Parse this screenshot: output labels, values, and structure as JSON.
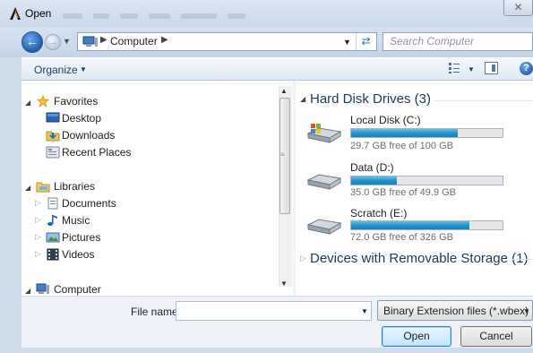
{
  "window": {
    "title": "Open",
    "close_glyph": "✕"
  },
  "address": {
    "path": [
      "Computer"
    ],
    "search_placeholder": "Search Computer"
  },
  "toolbar": {
    "organize_label": "Organize"
  },
  "nav": {
    "favorites": {
      "label": "Favorites",
      "items": [
        {
          "label": "Desktop",
          "icon": "desktop-icon"
        },
        {
          "label": "Downloads",
          "icon": "downloads-icon"
        },
        {
          "label": "Recent Places",
          "icon": "recent-places-icon"
        }
      ]
    },
    "libraries": {
      "label": "Libraries",
      "items": [
        {
          "label": "Documents",
          "icon": "documents-icon"
        },
        {
          "label": "Music",
          "icon": "music-icon"
        },
        {
          "label": "Pictures",
          "icon": "pictures-icon"
        },
        {
          "label": "Videos",
          "icon": "videos-icon"
        }
      ]
    },
    "computer": {
      "label": "Computer"
    }
  },
  "content": {
    "hard_disk_group": "Hard Disk Drives (3)",
    "drives": [
      {
        "name": "Local Disk (C:)",
        "free_text": "29.7 GB free of 100 GB",
        "used_fraction": 0.703,
        "icon": "windows-drive-icon"
      },
      {
        "name": "Data (D:)",
        "free_text": "35.0 GB free of 49.9 GB",
        "used_fraction": 0.299,
        "icon": "hard-drive-icon"
      },
      {
        "name": "Scratch (E:)",
        "free_text": "72.0 GB free of 326 GB",
        "used_fraction": 0.779,
        "icon": "hard-drive-icon"
      }
    ],
    "removable_group": "Devices with Removable Storage (1)"
  },
  "bottom": {
    "file_name_label": "File name:",
    "file_name_value": "",
    "filter_value": "Binary Extension files (*.wbex)",
    "open_label": "Open",
    "cancel_label": "Cancel"
  },
  "colors": {
    "accent": "#1e395b",
    "drive_bar": "#2692c8",
    "window_frame": "#cfdcec"
  }
}
